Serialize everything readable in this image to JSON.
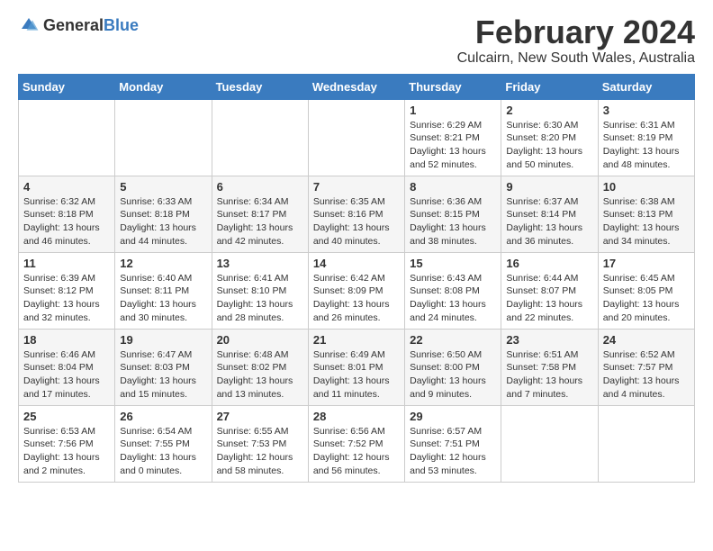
{
  "header": {
    "logo_general": "General",
    "logo_blue": "Blue",
    "month_title": "February 2024",
    "location": "Culcairn, New South Wales, Australia"
  },
  "days_of_week": [
    "Sunday",
    "Monday",
    "Tuesday",
    "Wednesday",
    "Thursday",
    "Friday",
    "Saturday"
  ],
  "weeks": [
    [
      {
        "day": "",
        "info": ""
      },
      {
        "day": "",
        "info": ""
      },
      {
        "day": "",
        "info": ""
      },
      {
        "day": "",
        "info": ""
      },
      {
        "day": "1",
        "info": "Sunrise: 6:29 AM\nSunset: 8:21 PM\nDaylight: 13 hours\nand 52 minutes."
      },
      {
        "day": "2",
        "info": "Sunrise: 6:30 AM\nSunset: 8:20 PM\nDaylight: 13 hours\nand 50 minutes."
      },
      {
        "day": "3",
        "info": "Sunrise: 6:31 AM\nSunset: 8:19 PM\nDaylight: 13 hours\nand 48 minutes."
      }
    ],
    [
      {
        "day": "4",
        "info": "Sunrise: 6:32 AM\nSunset: 8:18 PM\nDaylight: 13 hours\nand 46 minutes."
      },
      {
        "day": "5",
        "info": "Sunrise: 6:33 AM\nSunset: 8:18 PM\nDaylight: 13 hours\nand 44 minutes."
      },
      {
        "day": "6",
        "info": "Sunrise: 6:34 AM\nSunset: 8:17 PM\nDaylight: 13 hours\nand 42 minutes."
      },
      {
        "day": "7",
        "info": "Sunrise: 6:35 AM\nSunset: 8:16 PM\nDaylight: 13 hours\nand 40 minutes."
      },
      {
        "day": "8",
        "info": "Sunrise: 6:36 AM\nSunset: 8:15 PM\nDaylight: 13 hours\nand 38 minutes."
      },
      {
        "day": "9",
        "info": "Sunrise: 6:37 AM\nSunset: 8:14 PM\nDaylight: 13 hours\nand 36 minutes."
      },
      {
        "day": "10",
        "info": "Sunrise: 6:38 AM\nSunset: 8:13 PM\nDaylight: 13 hours\nand 34 minutes."
      }
    ],
    [
      {
        "day": "11",
        "info": "Sunrise: 6:39 AM\nSunset: 8:12 PM\nDaylight: 13 hours\nand 32 minutes."
      },
      {
        "day": "12",
        "info": "Sunrise: 6:40 AM\nSunset: 8:11 PM\nDaylight: 13 hours\nand 30 minutes."
      },
      {
        "day": "13",
        "info": "Sunrise: 6:41 AM\nSunset: 8:10 PM\nDaylight: 13 hours\nand 28 minutes."
      },
      {
        "day": "14",
        "info": "Sunrise: 6:42 AM\nSunset: 8:09 PM\nDaylight: 13 hours\nand 26 minutes."
      },
      {
        "day": "15",
        "info": "Sunrise: 6:43 AM\nSunset: 8:08 PM\nDaylight: 13 hours\nand 24 minutes."
      },
      {
        "day": "16",
        "info": "Sunrise: 6:44 AM\nSunset: 8:07 PM\nDaylight: 13 hours\nand 22 minutes."
      },
      {
        "day": "17",
        "info": "Sunrise: 6:45 AM\nSunset: 8:05 PM\nDaylight: 13 hours\nand 20 minutes."
      }
    ],
    [
      {
        "day": "18",
        "info": "Sunrise: 6:46 AM\nSunset: 8:04 PM\nDaylight: 13 hours\nand 17 minutes."
      },
      {
        "day": "19",
        "info": "Sunrise: 6:47 AM\nSunset: 8:03 PM\nDaylight: 13 hours\nand 15 minutes."
      },
      {
        "day": "20",
        "info": "Sunrise: 6:48 AM\nSunset: 8:02 PM\nDaylight: 13 hours\nand 13 minutes."
      },
      {
        "day": "21",
        "info": "Sunrise: 6:49 AM\nSunset: 8:01 PM\nDaylight: 13 hours\nand 11 minutes."
      },
      {
        "day": "22",
        "info": "Sunrise: 6:50 AM\nSunset: 8:00 PM\nDaylight: 13 hours\nand 9 minutes."
      },
      {
        "day": "23",
        "info": "Sunrise: 6:51 AM\nSunset: 7:58 PM\nDaylight: 13 hours\nand 7 minutes."
      },
      {
        "day": "24",
        "info": "Sunrise: 6:52 AM\nSunset: 7:57 PM\nDaylight: 13 hours\nand 4 minutes."
      }
    ],
    [
      {
        "day": "25",
        "info": "Sunrise: 6:53 AM\nSunset: 7:56 PM\nDaylight: 13 hours\nand 2 minutes."
      },
      {
        "day": "26",
        "info": "Sunrise: 6:54 AM\nSunset: 7:55 PM\nDaylight: 13 hours\nand 0 minutes."
      },
      {
        "day": "27",
        "info": "Sunrise: 6:55 AM\nSunset: 7:53 PM\nDaylight: 12 hours\nand 58 minutes."
      },
      {
        "day": "28",
        "info": "Sunrise: 6:56 AM\nSunset: 7:52 PM\nDaylight: 12 hours\nand 56 minutes."
      },
      {
        "day": "29",
        "info": "Sunrise: 6:57 AM\nSunset: 7:51 PM\nDaylight: 12 hours\nand 53 minutes."
      },
      {
        "day": "",
        "info": ""
      },
      {
        "day": "",
        "info": ""
      }
    ]
  ]
}
